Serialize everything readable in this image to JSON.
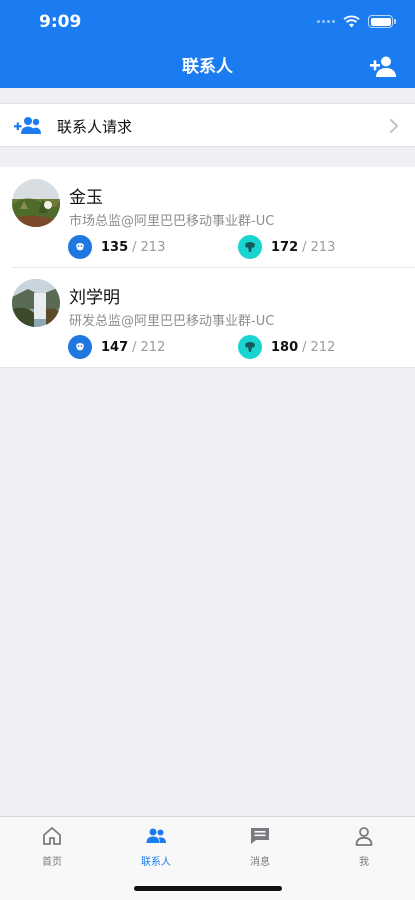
{
  "status_bar": {
    "time": "9:09"
  },
  "nav": {
    "title": "联系人",
    "add_icon": "add-person-icon"
  },
  "requests": {
    "label": "联系人请求",
    "icon": "add-group-icon"
  },
  "contacts": [
    {
      "name": "金玉",
      "title": "市场总监@阿里巴巴移动事业群-UC",
      "stats": [
        {
          "value": "135",
          "total": "213",
          "icon": "badge-blue-icon"
        },
        {
          "value": "172",
          "total": "213",
          "icon": "badge-cyan-icon"
        }
      ]
    },
    {
      "name": "刘学明",
      "title": "研发总监@阿里巴巴移动事业群-UC",
      "stats": [
        {
          "value": "147",
          "total": "212",
          "icon": "badge-blue-icon"
        },
        {
          "value": "180",
          "total": "212",
          "icon": "badge-cyan-icon"
        }
      ]
    }
  ],
  "stat_separator": "/",
  "tabs": [
    {
      "label": "首页",
      "icon": "home-icon",
      "active": false
    },
    {
      "label": "联系人",
      "icon": "contacts-icon",
      "active": true
    },
    {
      "label": "消息",
      "icon": "message-icon",
      "active": false
    },
    {
      "label": "我",
      "icon": "profile-icon",
      "active": false
    }
  ],
  "colors": {
    "primary": "#1a7cf0",
    "background": "#efeff4",
    "badge_blue": "#1f78e0",
    "badge_cyan": "#1ad4d0"
  }
}
